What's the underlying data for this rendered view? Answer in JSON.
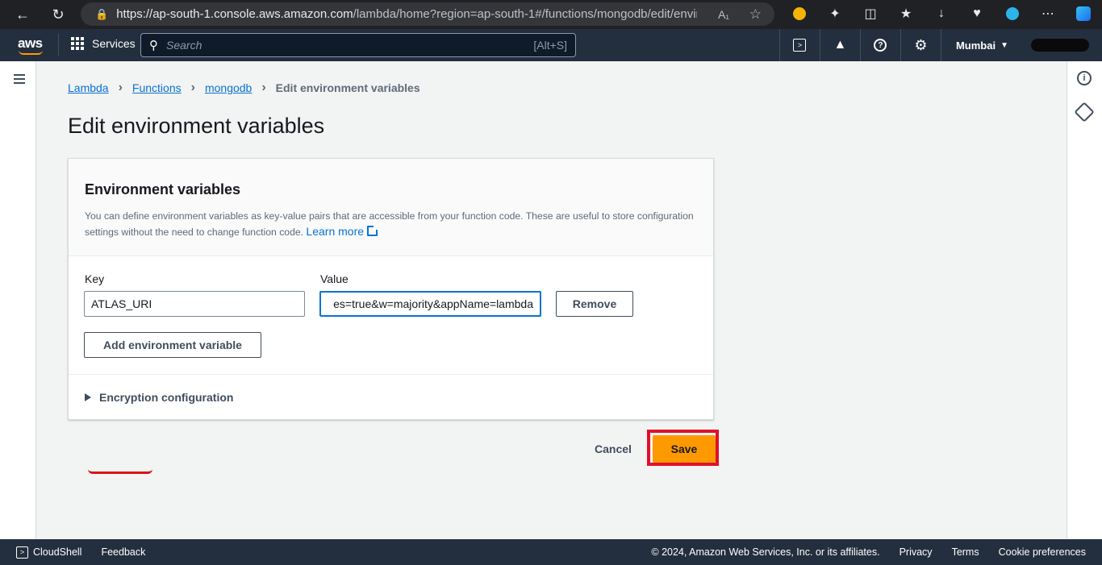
{
  "browser": {
    "url_host": "https://ap-south-1.console.aws.amazon.com",
    "url_path": "/lambda/home?region=ap-south-1#/functions/mongodb/edit/environ..."
  },
  "nav": {
    "logo": "aws",
    "services_label": "Services",
    "search_placeholder": "Search",
    "search_shortcut": "[Alt+S]",
    "region": "Mumbai"
  },
  "breadcrumb": {
    "items": [
      "Lambda",
      "Functions",
      "mongodb"
    ],
    "current": "Edit environment variables"
  },
  "page": {
    "title": "Edit environment variables"
  },
  "panel": {
    "title": "Environment variables",
    "description": "You can define environment variables as key-value pairs that are accessible from your function code. These are useful to store configuration settings without the need to change function code.",
    "learn_more": "Learn more",
    "key_label": "Key",
    "value_label": "Value",
    "variables": [
      {
        "key": "ATLAS_URI",
        "value": "es=true&w=majority&appName=lambda"
      }
    ],
    "remove_label": "Remove",
    "add_label": "Add environment variable",
    "encryption_label": "Encryption configuration"
  },
  "actions": {
    "cancel_label": "Cancel",
    "save_label": "Save"
  },
  "footer": {
    "cloudshell": "CloudShell",
    "feedback": "Feedback",
    "copyright": "© 2024, Amazon Web Services, Inc. or its affiliates.",
    "privacy": "Privacy",
    "terms": "Terms",
    "cookies": "Cookie preferences"
  },
  "colors": {
    "aws_nav": "#232f3e",
    "link": "#0972d3",
    "primary_button": "#ff9900",
    "highlight": "#e0102a"
  }
}
